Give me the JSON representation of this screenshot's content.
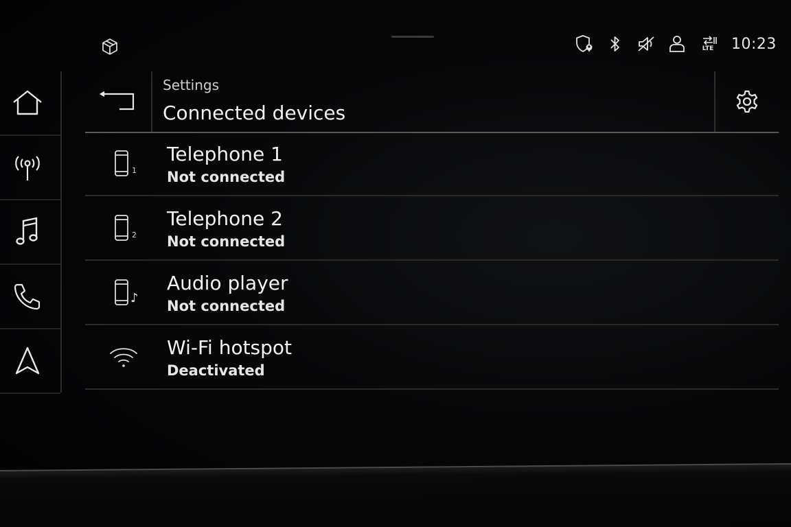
{
  "status_bar": {
    "icons": [
      "privacy-shield-icon",
      "bluetooth-icon",
      "mute-icon",
      "user-icon",
      "lte-icon"
    ],
    "lte_label": "LTE",
    "time": "10:23"
  },
  "rail": {
    "items": [
      {
        "name": "home",
        "icon": "home-icon"
      },
      {
        "name": "radio",
        "icon": "radio-antenna-icon"
      },
      {
        "name": "media",
        "icon": "music-note-icon"
      },
      {
        "name": "phone",
        "icon": "phone-icon"
      },
      {
        "name": "navigation",
        "icon": "navigation-arrow-icon"
      }
    ]
  },
  "header": {
    "breadcrumb": "Settings",
    "title": "Connected devices"
  },
  "devices": [
    {
      "title": "Telephone 1",
      "status": "Not connected",
      "icon": "phone-device-icon",
      "badge": "1"
    },
    {
      "title": "Telephone 2",
      "status": "Not connected",
      "icon": "phone-device-icon",
      "badge": "2"
    },
    {
      "title": "Audio player",
      "status": "Not connected",
      "icon": "audio-player-icon",
      "badge": "♪"
    },
    {
      "title": "Wi-Fi hotspot",
      "status": "Deactivated",
      "icon": "wifi-icon",
      "badge": ""
    }
  ],
  "colors": {
    "background": "#050506",
    "text": "#ececec",
    "divider": "#2a2a2a"
  }
}
